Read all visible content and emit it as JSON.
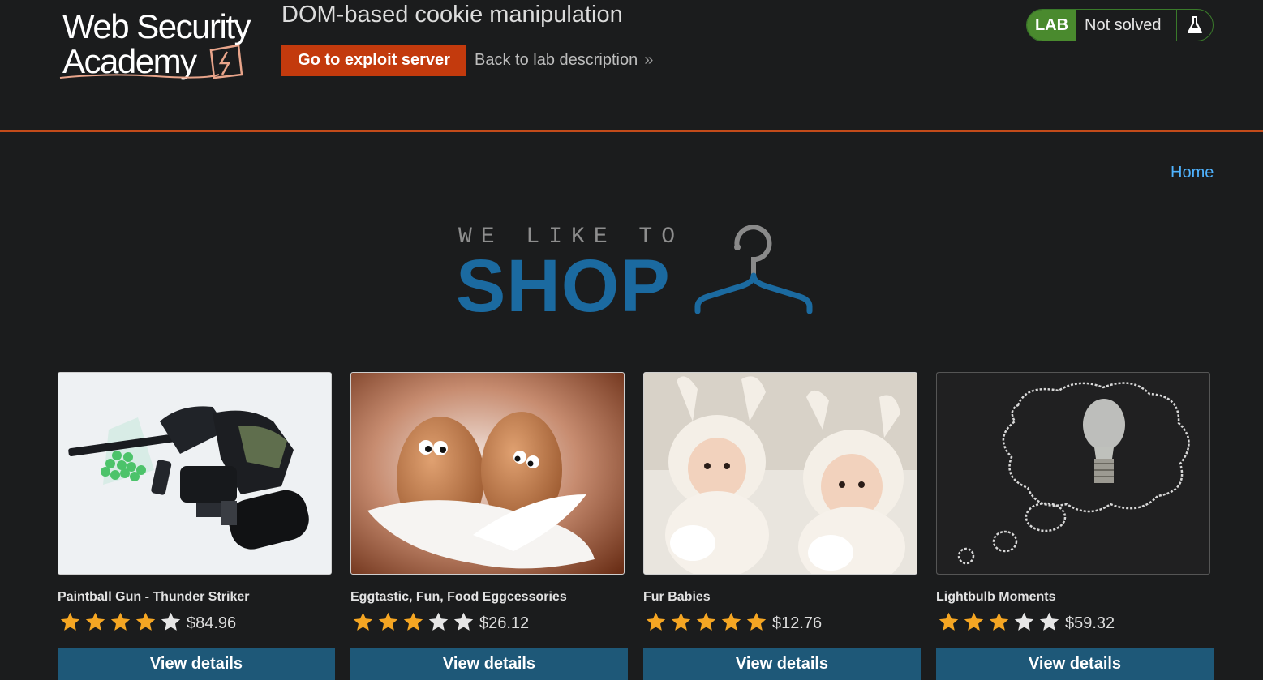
{
  "header": {
    "logo_line1": "Web Security",
    "logo_line2": "Academy",
    "lab_title": "DOM-based cookie manipulation",
    "exploit_button": "Go to exploit server",
    "back_link": "Back to lab description",
    "back_chevron": "»",
    "lab_badge": "LAB",
    "lab_status": "Not solved"
  },
  "nav": {
    "home": "Home"
  },
  "banner": {
    "top": "WE LIKE TO",
    "main": "SHOP"
  },
  "colors": {
    "accent_orange": "#c33a0d",
    "lab_green": "#4a8a2e",
    "link_blue": "#4fb3ff",
    "shop_blue": "#1b6aa0",
    "button_blue": "#1e5878",
    "star_filled": "#f5a623",
    "star_empty": "#e6e6e6"
  },
  "products": [
    {
      "name": "Paintball Gun - Thunder Striker",
      "rating": 4,
      "price": "$84.96",
      "button": "View details",
      "image": "paintball-gun-image"
    },
    {
      "name": "Eggtastic, Fun, Food Eggcessories",
      "rating": 3,
      "price": "$26.12",
      "button": "View details",
      "image": "eggs-image"
    },
    {
      "name": "Fur Babies",
      "rating": 5,
      "price": "$12.76",
      "button": "View details",
      "image": "babies-image"
    },
    {
      "name": "Lightbulb Moments",
      "rating": 3,
      "price": "$59.32",
      "button": "View details",
      "image": "lightbulb-image"
    }
  ]
}
